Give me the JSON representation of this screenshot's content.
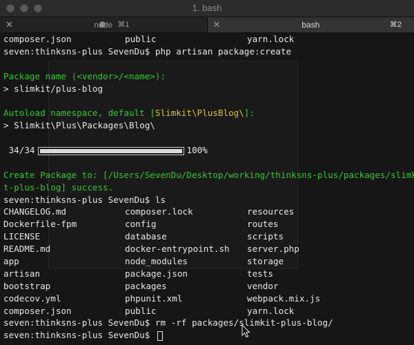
{
  "window": {
    "title": "1. bash"
  },
  "tabs": [
    {
      "label": "node",
      "shortcut": "⌘1",
      "active": false
    },
    {
      "label": "bash",
      "shortcut": "⌘2",
      "active": true
    }
  ],
  "terminal": {
    "top_row": [
      "composer.json",
      "public",
      "yarn.lock"
    ],
    "cmd1_prompt": "seven:thinksns-plus SevenDu$ ",
    "cmd1": "php artisan package:create",
    "q1": "Package name (<vendor>/<name>):",
    "a1": "> slimkit/plus-blog",
    "q2_prefix": "Autoload namespace, default [",
    "q2_default": "Slimkit\\PlusBlog\\",
    "q2_suffix": "]:",
    "a2": "> Slimkit\\Plus\\Packages\\Blog\\",
    "progress": {
      "count": "34/34",
      "percent": "100%",
      "fraction": 1.0
    },
    "created_1": "Create Package to: [/Users/SevenDu/Desktop/working/thinksns-plus/packages/slimki",
    "created_2": "t-plus-blog] success.",
    "cmd2_prompt": "seven:thinksns-plus SevenDu$ ",
    "cmd2": "ls",
    "ls_rows": [
      [
        "CHANGELOG.md",
        "composer.lock",
        "resources"
      ],
      [
        "Dockerfile-fpm",
        "config",
        "routes"
      ],
      [
        "LICENSE",
        "database",
        "scripts"
      ],
      [
        "README.md",
        "docker-entrypoint.sh",
        "server.php"
      ],
      [
        "app",
        "node_modules",
        "storage"
      ],
      [
        "artisan",
        "package.json",
        "tests"
      ],
      [
        "bootstrap",
        "packages",
        "vendor"
      ],
      [
        "codecov.yml",
        "phpunit.xml",
        "webpack.mix.js"
      ],
      [
        "composer.json",
        "public",
        "yarn.lock"
      ]
    ],
    "cmd3_prompt": "seven:thinksns-plus SevenDu$ ",
    "cmd3": "rm -rf packages/slimkit-plus-blog/",
    "cmd4_prompt": "seven:thinksns-plus SevenDu$ "
  },
  "colors": {
    "green": "#34c733",
    "yellow": "#d6c33a",
    "text": "#e6e6e6",
    "background": "#161616"
  }
}
